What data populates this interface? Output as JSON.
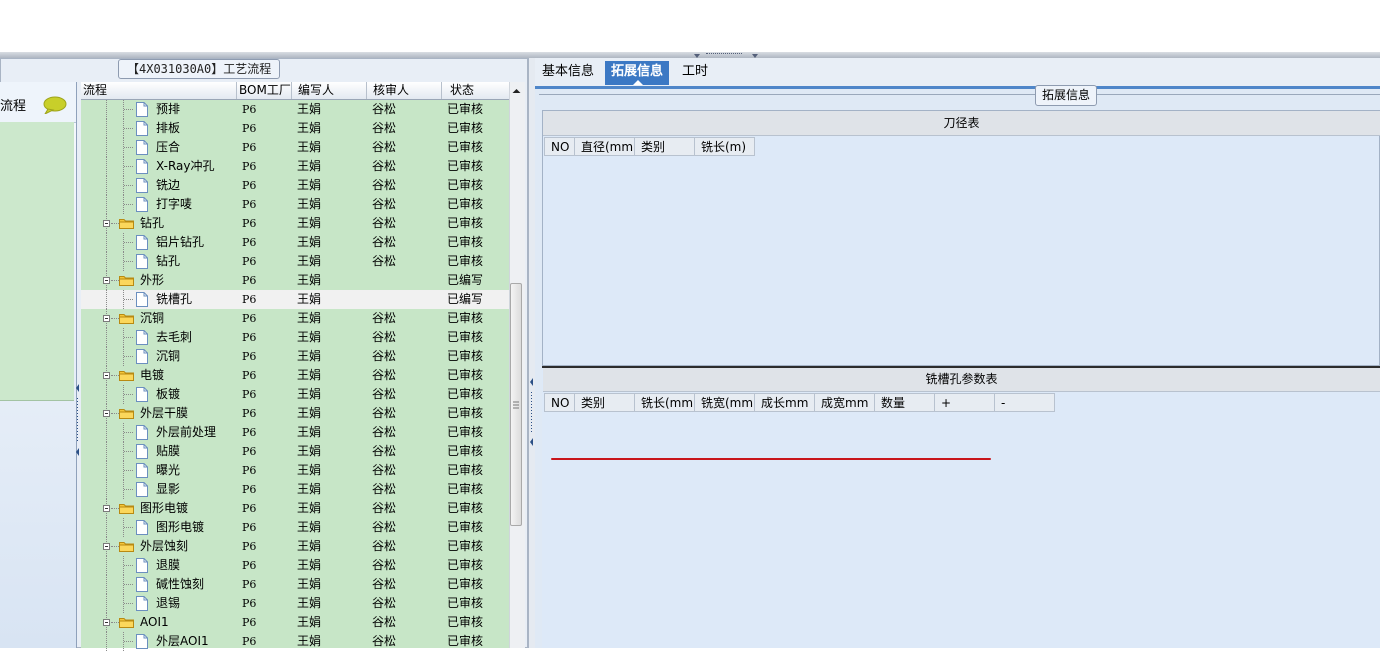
{
  "left_panel": {
    "group_title": "【4X031030A0】工艺流程",
    "sidebar_label": "流程",
    "columns": [
      "流程",
      "BOM工厂",
      "编写人",
      "核审人",
      "状态"
    ],
    "rows": [
      {
        "name": "预排",
        "level": 2,
        "bom": "P6",
        "writer": "王娟",
        "reviewer": "谷松",
        "status": "已审核"
      },
      {
        "name": "排板",
        "level": 2,
        "bom": "P6",
        "writer": "王娟",
        "reviewer": "谷松",
        "status": "已审核"
      },
      {
        "name": "压合",
        "level": 2,
        "bom": "P6",
        "writer": "王娟",
        "reviewer": "谷松",
        "status": "已审核"
      },
      {
        "name": "X-Ray冲孔",
        "level": 2,
        "bom": "P6",
        "writer": "王娟",
        "reviewer": "谷松",
        "status": "已审核"
      },
      {
        "name": "铣边",
        "level": 2,
        "bom": "P6",
        "writer": "王娟",
        "reviewer": "谷松",
        "status": "已审核"
      },
      {
        "name": "打字唛",
        "level": 2,
        "bom": "P6",
        "writer": "王娟",
        "reviewer": "谷松",
        "status": "已审核"
      },
      {
        "name": "钻孔",
        "level": 1,
        "bom": "P6",
        "writer": "王娟",
        "reviewer": "谷松",
        "status": "已审核"
      },
      {
        "name": "铝片钻孔",
        "level": 2,
        "bom": "P6",
        "writer": "王娟",
        "reviewer": "谷松",
        "status": "已审核"
      },
      {
        "name": "钻孔",
        "level": 2,
        "bom": "P6",
        "writer": "王娟",
        "reviewer": "谷松",
        "status": "已审核"
      },
      {
        "name": "外形",
        "level": 1,
        "bom": "P6",
        "writer": "王娟",
        "reviewer": "",
        "status": "已编写"
      },
      {
        "name": "铣槽孔",
        "level": 2,
        "bom": "P6",
        "writer": "王娟",
        "reviewer": "",
        "status": "已编写",
        "selected": true
      },
      {
        "name": "沉铜",
        "level": 1,
        "bom": "P6",
        "writer": "王娟",
        "reviewer": "谷松",
        "status": "已审核"
      },
      {
        "name": "去毛刺",
        "level": 2,
        "bom": "P6",
        "writer": "王娟",
        "reviewer": "谷松",
        "status": "已审核"
      },
      {
        "name": "沉铜",
        "level": 2,
        "bom": "P6",
        "writer": "王娟",
        "reviewer": "谷松",
        "status": "已审核"
      },
      {
        "name": "电镀",
        "level": 1,
        "bom": "P6",
        "writer": "王娟",
        "reviewer": "谷松",
        "status": "已审核"
      },
      {
        "name": "板镀",
        "level": 2,
        "bom": "P6",
        "writer": "王娟",
        "reviewer": "谷松",
        "status": "已审核"
      },
      {
        "name": "外层干膜",
        "level": 1,
        "bom": "P6",
        "writer": "王娟",
        "reviewer": "谷松",
        "status": "已审核"
      },
      {
        "name": "外层前处理",
        "level": 2,
        "bom": "P6",
        "writer": "王娟",
        "reviewer": "谷松",
        "status": "已审核"
      },
      {
        "name": "贴膜",
        "level": 2,
        "bom": "P6",
        "writer": "王娟",
        "reviewer": "谷松",
        "status": "已审核"
      },
      {
        "name": "曝光",
        "level": 2,
        "bom": "P6",
        "writer": "王娟",
        "reviewer": "谷松",
        "status": "已审核"
      },
      {
        "name": "显影",
        "level": 2,
        "bom": "P6",
        "writer": "王娟",
        "reviewer": "谷松",
        "status": "已审核"
      },
      {
        "name": "图形电镀",
        "level": 1,
        "bom": "P6",
        "writer": "王娟",
        "reviewer": "谷松",
        "status": "已审核"
      },
      {
        "name": "图形电镀",
        "level": 2,
        "bom": "P6",
        "writer": "王娟",
        "reviewer": "谷松",
        "status": "已审核"
      },
      {
        "name": "外层蚀刻",
        "level": 1,
        "bom": "P6",
        "writer": "王娟",
        "reviewer": "谷松",
        "status": "已审核"
      },
      {
        "name": "退膜",
        "level": 2,
        "bom": "P6",
        "writer": "王娟",
        "reviewer": "谷松",
        "status": "已审核"
      },
      {
        "name": "碱性蚀刻",
        "level": 2,
        "bom": "P6",
        "writer": "王娟",
        "reviewer": "谷松",
        "status": "已审核"
      },
      {
        "name": "退锡",
        "level": 2,
        "bom": "P6",
        "writer": "王娟",
        "reviewer": "谷松",
        "status": "已审核"
      },
      {
        "name": "AOI1",
        "level": 1,
        "bom": "P6",
        "writer": "王娟",
        "reviewer": "谷松",
        "status": "已审核"
      },
      {
        "name": "外层AOI1",
        "level": 2,
        "bom": "P6",
        "writer": "王娟",
        "reviewer": "谷松",
        "status": "已审核"
      }
    ]
  },
  "right_panel": {
    "tabs": [
      {
        "label": "基本信息",
        "active": false
      },
      {
        "label": "拓展信息",
        "active": true
      },
      {
        "label": "工时",
        "active": false
      }
    ],
    "group_title": "拓展信息",
    "knife_table": {
      "title": "刀径表",
      "columns": [
        "NO",
        "直径(mm)",
        "类别",
        "铣长(m)"
      ]
    },
    "slot_table": {
      "title": "铣槽孔参数表",
      "columns": [
        "NO",
        "类别",
        "铣长(mm)",
        "铣宽(mm)",
        "成长mm",
        "成宽mm",
        "数量",
        "+",
        "-"
      ]
    }
  },
  "colors": {
    "grid_bg": "#c7e6c7",
    "tab_active": "#3b78c4",
    "panel_bg": "#dde9f8",
    "annotation_line": "#c8151b"
  },
  "icons": [
    "folder-icon",
    "document-icon",
    "speech-bubble-icon",
    "scroll-up-arrow-icon"
  ]
}
